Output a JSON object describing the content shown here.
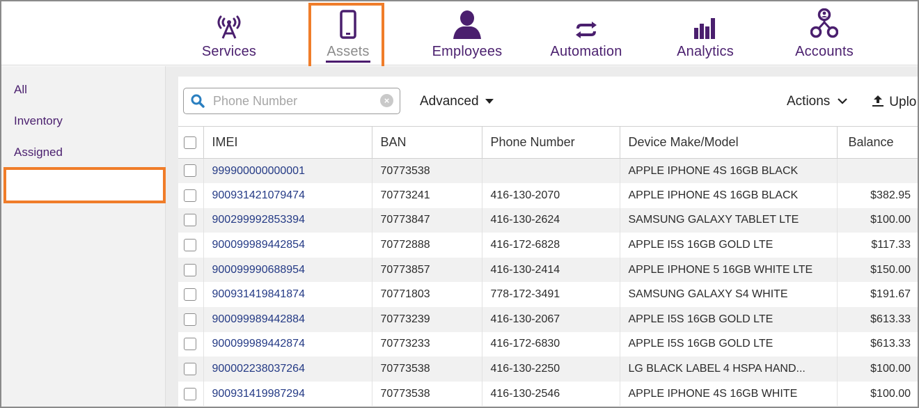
{
  "colors": {
    "brand_purple": "#4a1f6e",
    "highlight_orange": "#f07d2a",
    "link_blue": "#243a85"
  },
  "nav": {
    "items": [
      {
        "label": "Services",
        "icon": "antenna-icon"
      },
      {
        "label": "Assets",
        "icon": "phone-icon",
        "active": true
      },
      {
        "label": "Employees",
        "icon": "person-icon"
      },
      {
        "label": "Automation",
        "icon": "repeat-arrows-icon"
      },
      {
        "label": "Analytics",
        "icon": "bar-chart-icon"
      },
      {
        "label": "Accounts",
        "icon": "network-icon"
      }
    ]
  },
  "sidebar": {
    "items": [
      {
        "label": "All"
      },
      {
        "label": "Inventory",
        "active": true
      },
      {
        "label": "Assigned"
      }
    ]
  },
  "toolbar": {
    "search_placeholder": "Phone Number",
    "advanced_label": "Advanced",
    "actions_label": "Actions",
    "upload_label": "Uplo"
  },
  "table": {
    "columns": [
      "IMEI",
      "BAN",
      "Phone Number",
      "Device Make/Model",
      "Balance"
    ],
    "rows": [
      [
        "999900000000001",
        "70773538",
        "",
        "APPLE IPHONE 4S 16GB BLACK",
        ""
      ],
      [
        "900931421079474",
        "70773241",
        "416-130-2070",
        "APPLE IPHONE 4S 16GB BLACK",
        "$382.95"
      ],
      [
        "900299992853394",
        "70773847",
        "416-130-2624",
        "SAMSUNG GALAXY TABLET LTE",
        "$100.00"
      ],
      [
        "900099989442854",
        "70772888",
        "416-172-6828",
        "APPLE I5S 16GB GOLD LTE",
        "$117.33"
      ],
      [
        "900099990688954",
        "70773857",
        "416-130-2414",
        "APPLE IPHONE 5 16GB WHITE LTE",
        "$150.00"
      ],
      [
        "900931419841874",
        "70771803",
        "778-172-3491",
        "SAMSUNG GALAXY S4 WHITE",
        "$191.67"
      ],
      [
        "900099989442884",
        "70773239",
        "416-130-2067",
        "APPLE I5S 16GB GOLD LTE",
        "$613.33"
      ],
      [
        "900099989442874",
        "70773233",
        "416-172-6830",
        "APPLE I5S 16GB GOLD LTE",
        "$613.33"
      ],
      [
        "900002238037264",
        "70773538",
        "416-130-2250",
        "LG BLACK LABEL 4 HSPA HAND...",
        "$100.00"
      ],
      [
        "900931419987294",
        "70773538",
        "416-130-2546",
        "APPLE IPHONE 4S 16GB WHITE",
        "$100.00"
      ]
    ]
  }
}
